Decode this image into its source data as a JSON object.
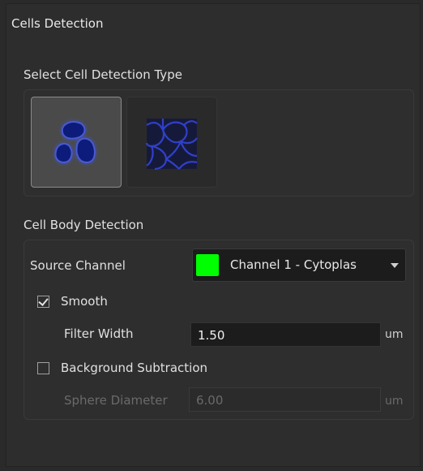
{
  "panel": {
    "title": "Cells Detection"
  },
  "detection_type": {
    "label": "Select Cell Detection Type",
    "options": [
      {
        "icon": "cells-blobs-icon",
        "selected": true
      },
      {
        "icon": "cell-membrane-icon",
        "selected": false
      }
    ]
  },
  "body_detection": {
    "label": "Cell Body Detection",
    "source_channel": {
      "label": "Source Channel",
      "value": "Channel 1 - Cytoplas",
      "swatch_color": "#00ff00"
    },
    "smooth": {
      "label": "Smooth",
      "checked": true
    },
    "filter_width": {
      "label": "Filter Width",
      "value": "1.50",
      "unit": "um"
    },
    "background_subtraction": {
      "label": "Background Subtraction",
      "checked": false
    },
    "sphere_diameter": {
      "label": "Sphere Diameter",
      "value": "6.00",
      "unit": "um"
    }
  },
  "colors": {
    "accent_cell": "#0a1a7a",
    "glow": "#4a5ad0"
  }
}
